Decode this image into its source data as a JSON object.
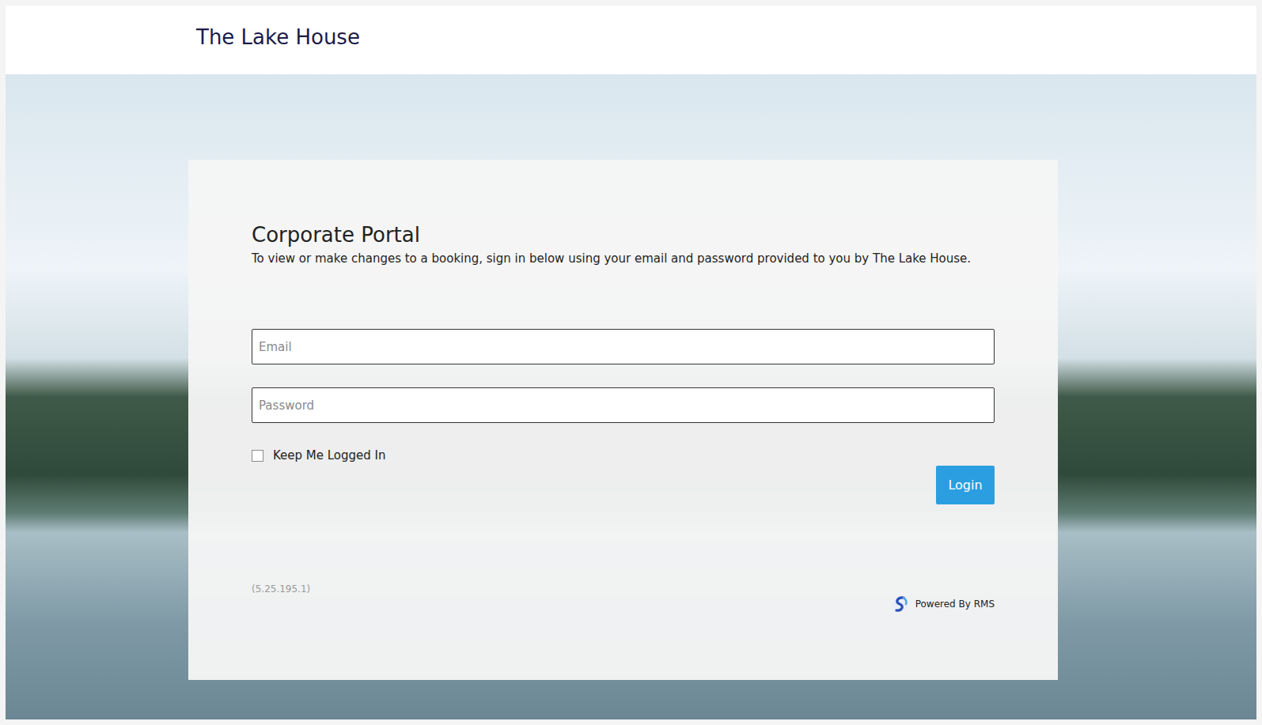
{
  "header": {
    "title": "The Lake House"
  },
  "portal": {
    "title": "Corporate Portal",
    "subtitle": "To view or make changes to a booking, sign in below using your email and password provided to you by The Lake House."
  },
  "fields": [
    {
      "name": "email",
      "placeholder": "Email",
      "type": "email"
    },
    {
      "name": "password",
      "placeholder": "Password",
      "type": "password"
    }
  ],
  "keep_logged_in": {
    "label": "Keep Me Logged In",
    "checked": false
  },
  "buttons": [
    "Login"
  ],
  "footer": {
    "version": "(5.25.195.1)",
    "powered_by": "Powered By RMS"
  }
}
